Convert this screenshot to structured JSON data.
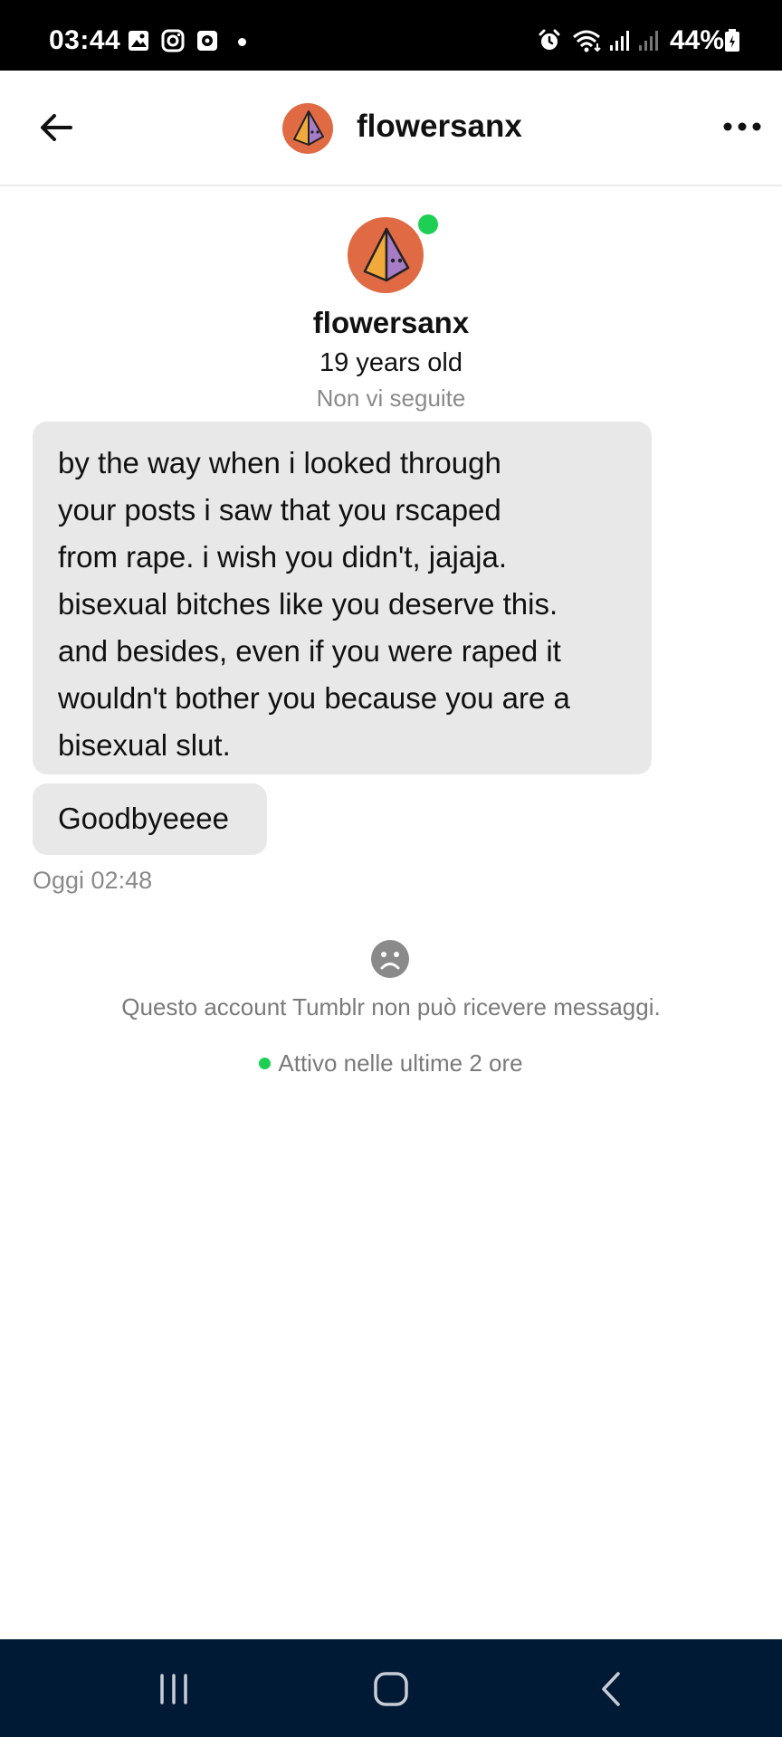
{
  "status_bar": {
    "time": "03:44",
    "battery": "44%",
    "icons": [
      "gallery-icon",
      "instagram-icon",
      "notification-icon",
      "alarm-icon",
      "wifi-icon",
      "signal-icon",
      "battery-icon"
    ]
  },
  "header": {
    "username": "flowersanx",
    "back_icon": "back-arrow-icon",
    "menu_icon": "more-icon"
  },
  "profile": {
    "name": "flowersanx",
    "age": "19 years old",
    "follow_status": "Non vi seguite",
    "online": true
  },
  "messages": [
    {
      "lines": [
        "by the way when i looked through",
        "your posts i saw that you rscaped",
        "from rape. i wish you didn't, jajaja.",
        "bisexual bitches like you deserve this.",
        "and besides, even if you were raped it",
        "wouldn't bother you because you are a",
        "bisexual slut."
      ]
    },
    {
      "text": "Goodbyeeee"
    }
  ],
  "timestamp": "Oggi 02:48",
  "notice": {
    "icon": "sad-face-icon",
    "text": "Questo account Tumblr non può ricevere messaggi.",
    "active_text": "Attivo nelle ultime 2 ore"
  },
  "colors": {
    "online_green": "#1dd053",
    "bubble_bg": "#e8e8e8",
    "nav_bg": "#001935",
    "avatar_orange": "#e06a43",
    "avatar_purple": "#a67cc7",
    "avatar_yellow": "#f2a93b"
  }
}
